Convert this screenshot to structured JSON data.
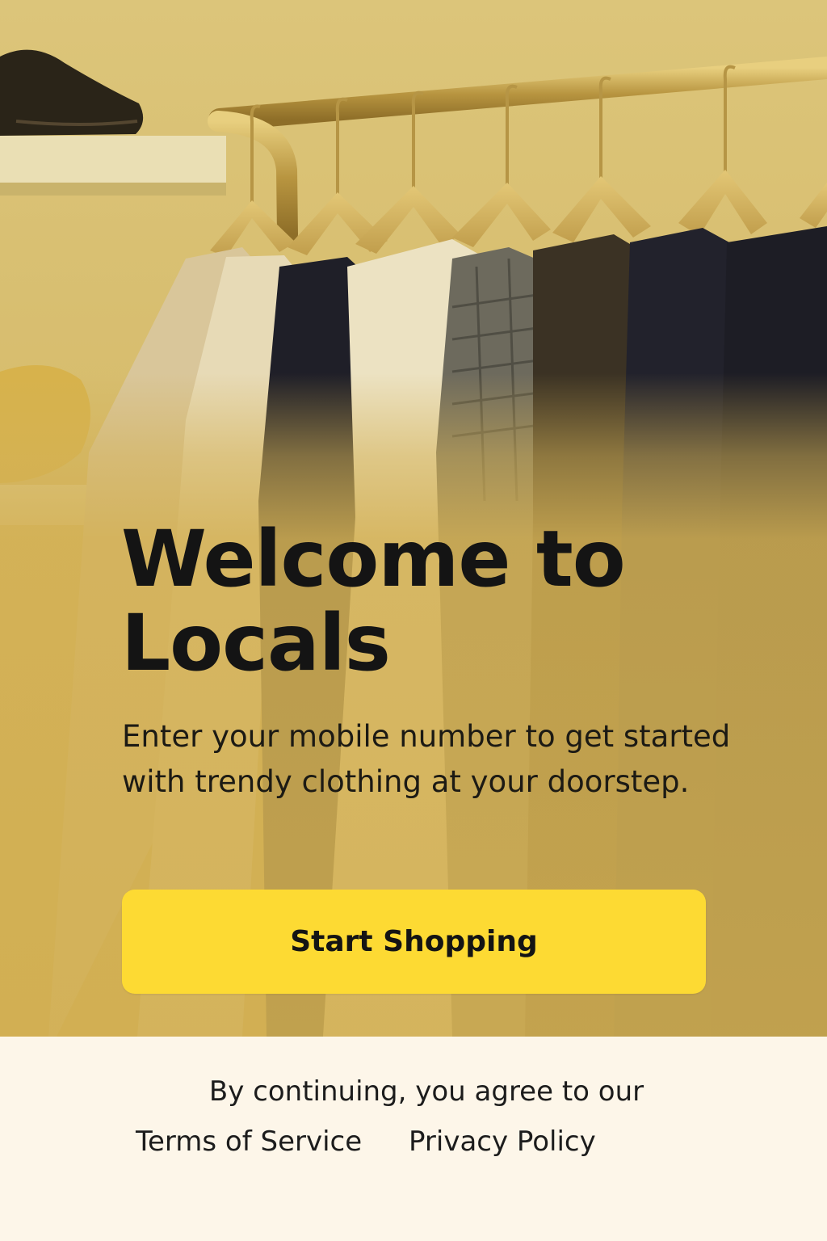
{
  "hero": {
    "title": "Welcome to Locals",
    "subtitle": "Enter your mobile number to get started with trendy clothing at your doorstep.",
    "cta_label": "Start Shopping"
  },
  "footer": {
    "agree_text": "By continuing, you agree to our",
    "terms_label": "Terms of Service",
    "privacy_label": "Privacy Policy"
  },
  "colors": {
    "accent": "#fdda33",
    "hero_tint": "#d4b55e",
    "footer_background": "#fdf6e9",
    "text": "#141414"
  }
}
